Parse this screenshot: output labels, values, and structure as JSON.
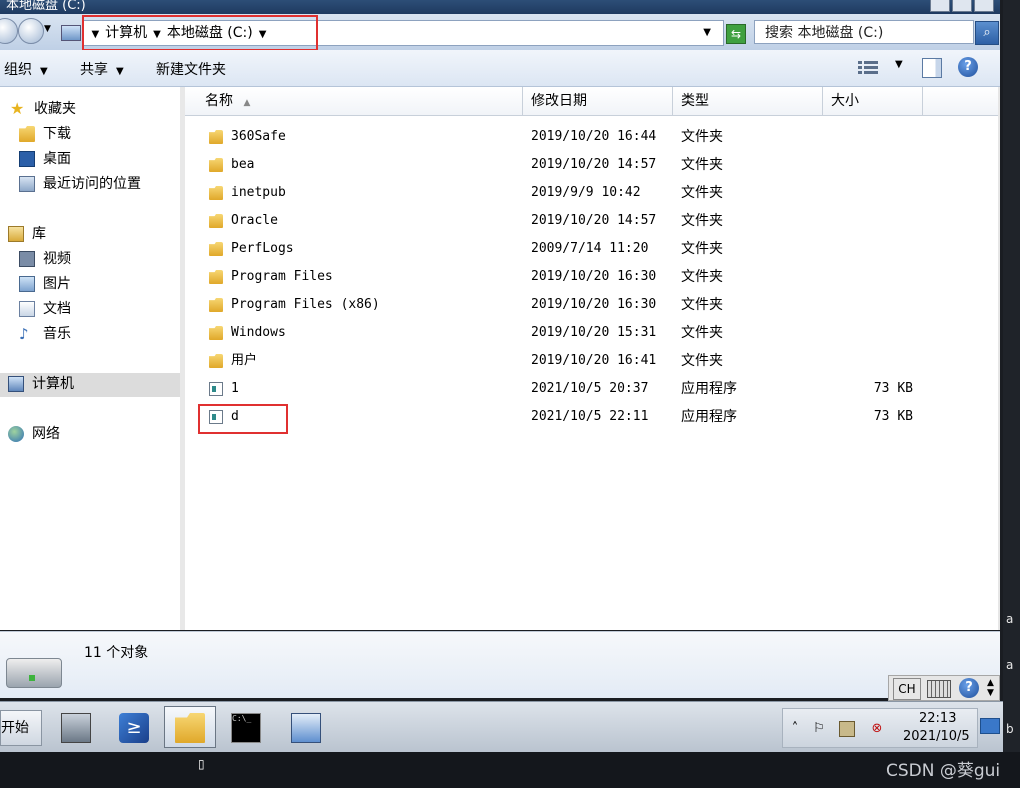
{
  "window": {
    "title": "本地磁盘 (C:)"
  },
  "address": {
    "computer": "计算机",
    "drive": "本地磁盘 (C:)",
    "search_placeholder": "搜索 本地磁盘 (C:)"
  },
  "toolbar": {
    "organize": "组织",
    "share": "共享",
    "new_folder": "新建文件夹"
  },
  "nav": {
    "favorites": "收藏夹",
    "downloads": "下载",
    "desktop": "桌面",
    "recent": "最近访问的位置",
    "libraries": "库",
    "videos": "视频",
    "pictures": "图片",
    "documents": "文档",
    "music": "音乐",
    "computer": "计算机",
    "network": "网络"
  },
  "columns": {
    "name": "名称",
    "modified": "修改日期",
    "type": "类型",
    "size": "大小"
  },
  "files": [
    {
      "name": "360Safe",
      "modified": "2019/10/20 16:44",
      "type": "文件夹",
      "size": "",
      "kind": "folder"
    },
    {
      "name": "bea",
      "modified": "2019/10/20 14:57",
      "type": "文件夹",
      "size": "",
      "kind": "folder"
    },
    {
      "name": "inetpub",
      "modified": "2019/9/9 10:42",
      "type": "文件夹",
      "size": "",
      "kind": "folder"
    },
    {
      "name": "Oracle",
      "modified": "2019/10/20 14:57",
      "type": "文件夹",
      "size": "",
      "kind": "folder"
    },
    {
      "name": "PerfLogs",
      "modified": "2009/7/14 11:20",
      "type": "文件夹",
      "size": "",
      "kind": "folder"
    },
    {
      "name": "Program Files",
      "modified": "2019/10/20 16:30",
      "type": "文件夹",
      "size": "",
      "kind": "folder"
    },
    {
      "name": "Program Files (x86)",
      "modified": "2019/10/20 16:30",
      "type": "文件夹",
      "size": "",
      "kind": "folder"
    },
    {
      "name": "Windows",
      "modified": "2019/10/20 15:31",
      "type": "文件夹",
      "size": "",
      "kind": "folder"
    },
    {
      "name": "用户",
      "modified": "2019/10/20 16:41",
      "type": "文件夹",
      "size": "",
      "kind": "folder"
    },
    {
      "name": "1",
      "modified": "2021/10/5 20:37",
      "type": "应用程序",
      "size": "73 KB",
      "kind": "app"
    },
    {
      "name": "d",
      "modified": "2021/10/5 22:11",
      "type": "应用程序",
      "size": "73 KB",
      "kind": "app"
    }
  ],
  "details": {
    "count": "11 个对象"
  },
  "langbar": {
    "lang": "CH"
  },
  "taskbar": {
    "start": "开始",
    "clock_time": "22:13",
    "clock_date": "2021/10/5"
  },
  "side_letters": [
    "a",
    "a",
    "b"
  ],
  "watermark": "CSDN @葵gui"
}
